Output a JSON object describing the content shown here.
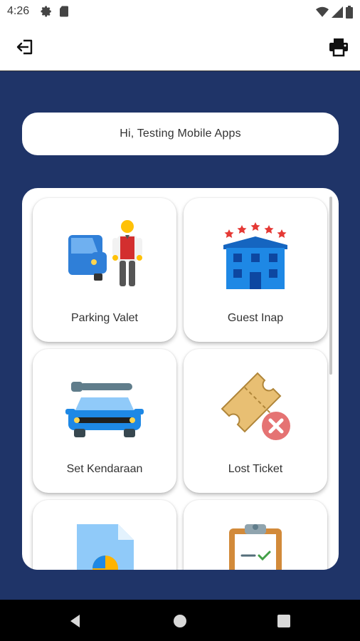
{
  "status_bar": {
    "time": "4:26",
    "icons_left": [
      "gear-icon",
      "sd-card-icon"
    ],
    "icons_right": [
      "wifi-icon",
      "signal-icon",
      "battery-icon"
    ]
  },
  "app_bar": {
    "left_icon": "logout-icon",
    "right_icon": "printer-icon"
  },
  "greeting": "Hi, Testing Mobile Apps",
  "menu": {
    "items": [
      {
        "label": "Parking Valet",
        "icon": "valet-icon"
      },
      {
        "label": "Guest Inap",
        "icon": "hotel-icon"
      },
      {
        "label": "Set Kendaraan",
        "icon": "car-wrench-icon"
      },
      {
        "label": "Lost Ticket",
        "icon": "lost-ticket-icon"
      },
      {
        "label": "",
        "icon": "report-document-icon"
      },
      {
        "label": "",
        "icon": "clipboard-icon"
      }
    ]
  },
  "nav_bar": [
    "back-icon",
    "home-icon",
    "recents-icon"
  ],
  "colors": {
    "background_main": "#1f3468",
    "panel": "#ffffff",
    "text": "#333333",
    "nav_bar": "#000000"
  }
}
